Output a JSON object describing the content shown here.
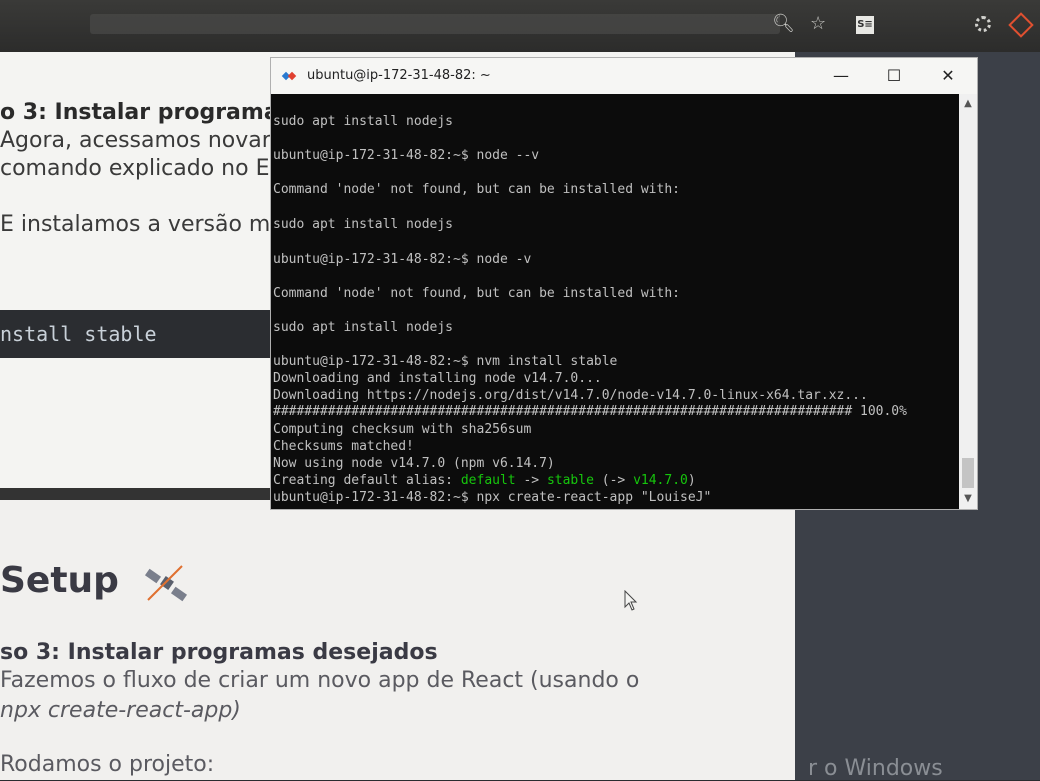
{
  "browser": {
    "url": "...",
    "icons": [
      "star-icon",
      "reader-mode-icon",
      "extension-icon",
      "shield-icon"
    ]
  },
  "page": {
    "step_heading": "o 3: Instalar programas",
    "para_1": "Agora, acessamos novar",
    "para_2": "comando explicado no E",
    "para_3": "E instalamos a versão m",
    "code": "nstall stable",
    "setup_title": "Setup",
    "step_heading_2": "so 3: Instalar programas desejados",
    "para_4": "Fazemos o fluxo de criar um novo app de React (usando o",
    "para_5": "npx create-react-app)",
    "para_6": "Rodamos o projeto:",
    "watermark": "r o Windows"
  },
  "terminal": {
    "title": "ubuntu@ip-172-31-48-82: ~",
    "controls": {
      "minimize": "—",
      "maximize": "☐",
      "close": "✕"
    },
    "lines": [
      "sudo apt install nodejs",
      "",
      "ubuntu@ip-172-31-48-82:~$ node --v",
      "",
      "Command 'node' not found, but can be installed with:",
      "",
      "sudo apt install nodejs",
      "",
      "ubuntu@ip-172-31-48-82:~$ node -v",
      "",
      "Command 'node' not found, but can be installed with:",
      "",
      "sudo apt install nodejs",
      "",
      "ubuntu@ip-172-31-48-82:~$ nvm install stable",
      "Downloading and installing node v14.7.0...",
      "Downloading https://nodejs.org/dist/v14.7.0/node-v14.7.0-linux-x64.tar.xz...",
      "########################################################################## 100.0%",
      "Computing checksum with sha256sum",
      "Checksums matched!",
      "Now using node v14.7.0 (npm v6.14.7)",
      "Creating default alias: ",
      "ubuntu@ip-172-31-48-82:~$ npx create-react-app \"LouiseJ\""
    ],
    "alias_default": "default",
    "alias_arrow": " -> ",
    "alias_stable": "stable",
    "alias_paren_open": " (-> ",
    "alias_version": "v14.7.0",
    "alias_paren_close": ")"
  },
  "colors": {
    "terminal_bg": "#0c0c0c",
    "terminal_text": "#c0c0c0",
    "alias_green": "#16c60c"
  }
}
